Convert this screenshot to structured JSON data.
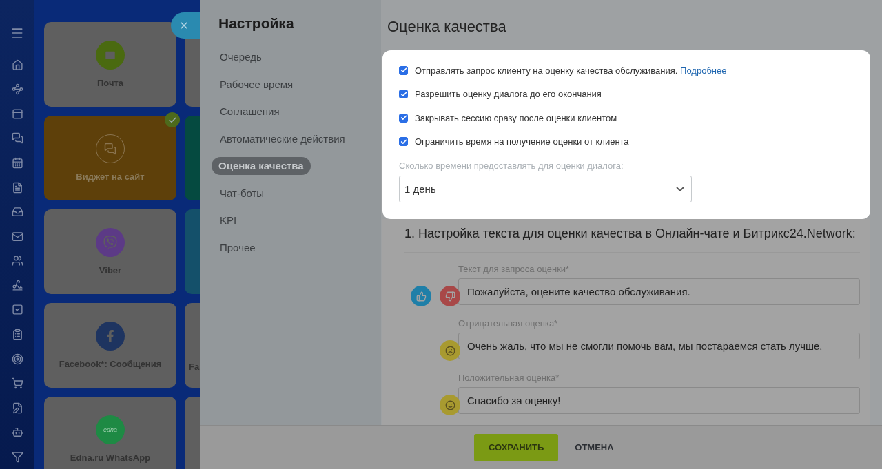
{
  "tiles": [
    {
      "kind": "mail",
      "label": "Почта",
      "color": "#4a6a10",
      "selected": false
    },
    {
      "kind": "chat",
      "label": "Виджет на сайт",
      "color": "#8a7450",
      "selected": true
    },
    {
      "kind": "viber",
      "label": "Viber",
      "color": "#5c3a86",
      "selected": false
    },
    {
      "kind": "facebook",
      "label": "Facebook*: Сообщения",
      "color": "#1e3460",
      "selected": false
    },
    {
      "kind": "edna",
      "label": "Edna.ru WhatsApp",
      "logo_text": "edna",
      "color": "#1e8a44",
      "selected": false
    }
  ],
  "tiles_column_2": [
    {
      "color": "#5f5f5f"
    },
    {
      "color": "#054a40"
    },
    {
      "color": "#14506a"
    },
    {
      "color": "#5f5f5f",
      "label": "Fa"
    },
    {
      "color": "#5f5f5f"
    }
  ],
  "settings_nav": {
    "title": "Настройка",
    "items": [
      {
        "label": "Очередь",
        "selected": false
      },
      {
        "label": "Рабочее время",
        "selected": false
      },
      {
        "label": "Соглашения",
        "selected": false
      },
      {
        "label": "Автоматические действия",
        "selected": false
      },
      {
        "label": "Оценка качества",
        "selected": true
      },
      {
        "label": "Чат-боты",
        "selected": false
      },
      {
        "label": "KPI",
        "selected": false
      },
      {
        "label": "Прочее",
        "selected": false
      }
    ]
  },
  "page_title": "Оценка качества",
  "options": [
    {
      "label": "Отправлять запрос клиенту на оценку качества обслуживания.",
      "link": "Подробнее",
      "checked": true
    },
    {
      "label": "Разрешить оценку диалога до его окончания",
      "checked": true
    },
    {
      "label": "Закрывать сессию сразу после оценки клиентом",
      "checked": true
    },
    {
      "label": "Ограничить время на получение оценки от клиента",
      "checked": true
    }
  ],
  "duration": {
    "label": "Сколько времени предоставлять для оценки диалога:",
    "value": "1 день"
  },
  "text_section": {
    "heading": "1. Настройка текста для оценки качества в Онлайн-чате и Битрикс24.Network:",
    "fields": [
      {
        "kind": "request",
        "label": "Текст для запроса оценки*",
        "value": "Пожалуйста, оцените качество обслуживания."
      },
      {
        "kind": "negative",
        "label": "Отрицательная оценка*",
        "value": "Очень жаль, что мы не смогли помочь вам, мы постараемся стать лучше."
      },
      {
        "kind": "positive",
        "label": "Положительная оценка*",
        "value": "Спасибо за оценку!"
      }
    ]
  },
  "footer": {
    "save": "СОХРАНИТЬ",
    "cancel": "ОТМЕНА"
  }
}
